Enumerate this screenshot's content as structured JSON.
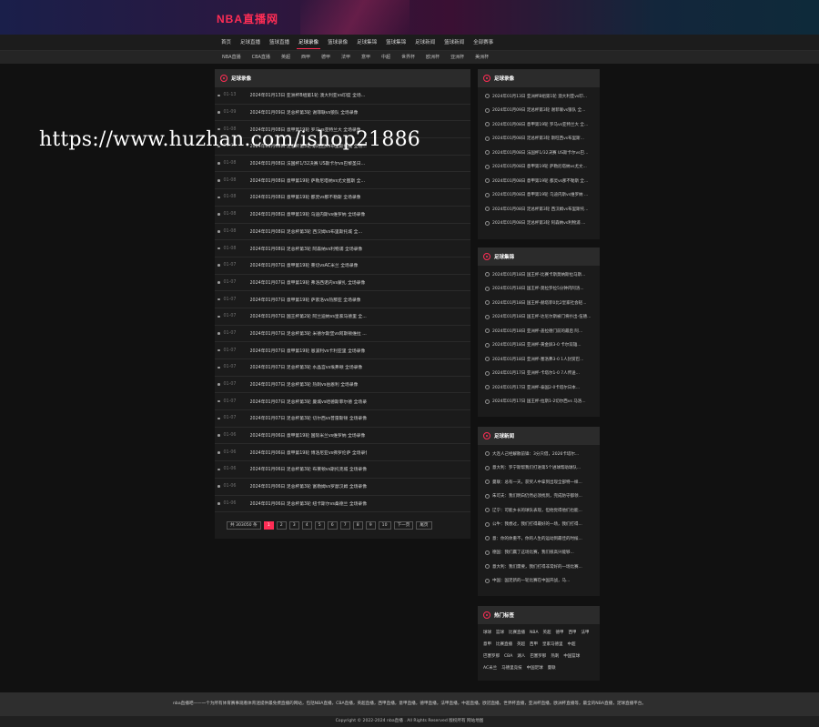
{
  "header": {
    "logo": "NBA直播网"
  },
  "nav_primary": [
    {
      "label": "首页",
      "active": false
    },
    {
      "label": "足球直播",
      "active": false
    },
    {
      "label": "篮球直播",
      "active": false
    },
    {
      "label": "足球录像",
      "active": true
    },
    {
      "label": "篮球录像",
      "active": false
    },
    {
      "label": "足球集锦",
      "active": false
    },
    {
      "label": "篮球集锦",
      "active": false
    },
    {
      "label": "足球新闻",
      "active": false
    },
    {
      "label": "篮球新闻",
      "active": false
    },
    {
      "label": "全部赛事",
      "active": false
    }
  ],
  "nav_secondary": [
    "NBA直播",
    "CBA直播",
    "英超",
    "西甲",
    "德甲",
    "法甲",
    "意甲",
    "中超",
    "世界杯",
    "欧洲杯",
    "亚洲杯",
    "美洲杯"
  ],
  "main": {
    "title": "足球录像",
    "rows": [
      {
        "date": "01-13",
        "text": "2024年01月13日 亚洲杯B组第1轮 澳大利亚vs印度 全场..."
      },
      {
        "date": "01-09",
        "text": "2024年01月09日 足总杯第3轮 谢菲联vs狼队 全场录像"
      },
      {
        "date": "01-08",
        "text": "2024年01月08日 意甲第19轮 罗马vs亚特兰大 全场录像"
      },
      {
        "date": "01-08",
        "text": "2024年01月08日 足总杯第3轮 斯旺西vs布里斯托城 全场..."
      },
      {
        "date": "01-08",
        "text": "2024年01月08日 法国杯1/32决赛 US斯卡尔vs巴黎圣日..."
      },
      {
        "date": "01-08",
        "text": "2024年01月08日 意甲第19轮 萨勒尼塔纳vs尤文图斯 全..."
      },
      {
        "date": "01-08",
        "text": "2024年01月08日 意甲第19轮 都灵vs那不勒斯 全场录像"
      },
      {
        "date": "01-08",
        "text": "2024年01月08日 意甲第19轮 乌迪内斯vs维罗纳 全场录像"
      },
      {
        "date": "01-08",
        "text": "2024年01月08日 足总杯第3轮 西汉姆vs布里斯托城 全..."
      },
      {
        "date": "01-08",
        "text": "2024年01月08日 足总杯第3轮 阿森纳vs利物浦 全场录像"
      },
      {
        "date": "01-07",
        "text": "2024年01月07日 意甲第19轮 莱切vsAC米兰 全场录像"
      },
      {
        "date": "01-07",
        "text": "2024年01月07日 意甲第19轮 弗洛西诺内vs蒙扎 全场录像"
      },
      {
        "date": "01-07",
        "text": "2024年01月07日 意甲第19轮 萨索洛vs热那亚 全场录像"
      },
      {
        "date": "01-07",
        "text": "2024年01月07日 国王杯第2轮 阿兰迪纳vs皇家马德里 全..."
      },
      {
        "date": "01-07",
        "text": "2024年01月07日 足总杯第3轮 米德尔斯堡vs阿斯顿维拉 ..."
      },
      {
        "date": "01-07",
        "text": "2024年01月07日 意甲第19轮 恩波利vs卡利亚里 全场录像"
      },
      {
        "date": "01-07",
        "text": "2024年01月07日 足总杯第3轮 水晶宫vs埃弗顿 全场录像"
      },
      {
        "date": "01-07",
        "text": "2024年01月07日 足总杯第3轮 热刺vs伯恩利 全场录像"
      },
      {
        "date": "01-07",
        "text": "2024年01月07日 足总杯第3轮 曼城vs哈德斯菲尔德 全场录像"
      },
      {
        "date": "01-07",
        "text": "2024年01月07日 足总杯第3轮 切尔西vs普雷斯顿 全场录像"
      },
      {
        "date": "01-06",
        "text": "2024年01月06日 意甲第19轮 国际米兰vs维罗纳 全场录像"
      },
      {
        "date": "01-06",
        "text": "2024年01月06日 意甲第19轮 博洛尼亚vs佛罗伦萨 全场录像"
      },
      {
        "date": "01-06",
        "text": "2024年01月06日 足总杯第3轮 布莱顿vs斯托克城 全场录像"
      },
      {
        "date": "01-06",
        "text": "2024年01月06日 足总杯第3轮 富勒姆vs罗瑟汉姆 全场录像"
      },
      {
        "date": "01-06",
        "text": "2024年01月06日 足总杯第3轮 纽卡斯尔vs桑德兰 全场录像"
      }
    ],
    "pager": {
      "total": "共 303050 条",
      "pages": [
        "1",
        "2",
        "3",
        "4",
        "5",
        "6",
        "7",
        "8",
        "9",
        "10"
      ],
      "current": "1",
      "next": "下一页",
      "last": "尾页"
    }
  },
  "side_videos": {
    "title": "足球录像",
    "items": [
      "2024年01月13日 亚洲杯B组第1轮 澳大利亚vs印...",
      "2024年01月09日 足总杯第3轮 谢菲联vs狼队 全...",
      "2024年01月08日 意甲第19轮 罗马vs亚特兰大 全...",
      "2024年01月08日 足总杯第3轮 斯旺西vs布里斯...",
      "2024年01月08日 法国杯1/32决赛 US斯卡尔vs巴...",
      "2024年01月08日 意甲第19轮 萨勒尼塔纳vs尤文...",
      "2024年01月08日 意甲第19轮 都灵vs那不勒斯 全...",
      "2024年01月08日 意甲第19轮 乌迪内斯vs维罗纳 ...",
      "2024年01月08日 足总杯第3轮 西汉姆vs布里斯托...",
      "2024年01月08日 足总杯第3轮 阿森纳vs利物浦 ..."
    ]
  },
  "side_highlights": {
    "title": "足球集锦",
    "items": [
      "2024年01月18日 国王杯-比赛卡斯莫纳斯拉马斯...",
      "2024年01月18日 国王杯-莫拉罗拉5分钟内阿洛...",
      "2024年01月18日 国王杯-赫塔菲0比2皇家社会轻...",
      "2024年01月18日 国王杯-达尼尔斯被门将扑出-伍德...",
      "2024年01月18日 亚洲杯-盖拉德门前的最后 阿...",
      "2024年01月18日 亚洲杯-黄金屏3-0 卡尔双雄...",
      "2024年01月18日 亚洲杯-塞洛弗3-0 1人封赏巴...",
      "2024年01月17日 亚洲杯-卡塔尔1-0 7人传送...",
      "2024年01月17日 亚洲杯-泰国2-0卡塔尔日本...",
      "2024年01月17日 国王杯-拉斯1-2切尔西vs 马洛..."
    ]
  },
  "side_news": {
    "title": "足球新闻",
    "items": [
      "大连人己经解散前锋：3分只借，2026卡塔尔...",
      "意大利：罗宁斯帮我们打进第5个进球帮助球队...",
      "曼联：总有一天，获奖人中拿到出现全部特一样...",
      "朱可夫：我们明白仍然必须找到，完成防守都领...",
      "辽宁：可能乡长的球队表现，但他觉得他们也能...",
      "公牛：我想过，我们打得最好的一场，我们打得...",
      "意：你的体重不，你的人生的运动到最佳的时候...",
      "德国：我们赢了这场比赛，我们很高兴能够...",
      "意大利：我们需要，我们打得非常好的一场比赛...",
      "中国：国足新的一轮比赛在中国开战，马..."
    ]
  },
  "side_tags": {
    "title": "热门标签",
    "tags": [
      "球球",
      "篮球",
      "比赛直播",
      "NBA",
      "英超",
      "德甲",
      "西甲",
      "法甲",
      "意甲",
      "比赛直播",
      "英超",
      "西甲",
      "皇家马德里",
      "中超",
      "巴塞罗那",
      "CBA",
      "湖人",
      "巴塞罗那",
      "热刺",
      "中国篮球",
      "AC米兰",
      "马德里竞技",
      "中国足球",
      "曼联"
    ]
  },
  "footer": {
    "desc": "nba直播吧——一个为所有体育赛事观看体育迷提供最免费直播的网站，包括NBA直播，CBA直播，英超直播，西甲直播，意甲直播，德甲直播，法甲直播，中超直播，欧冠直播，世界杯直播，亚洲杯直播，欧洲杯直播等，最全的NBA直播，足球直播平台。",
    "copyright": "Copyright © 2022-2024 nba直播 . All Rights Reserved 版权所有 网站地图"
  },
  "watermark": "https://www.huzhan.com/ishop21886"
}
